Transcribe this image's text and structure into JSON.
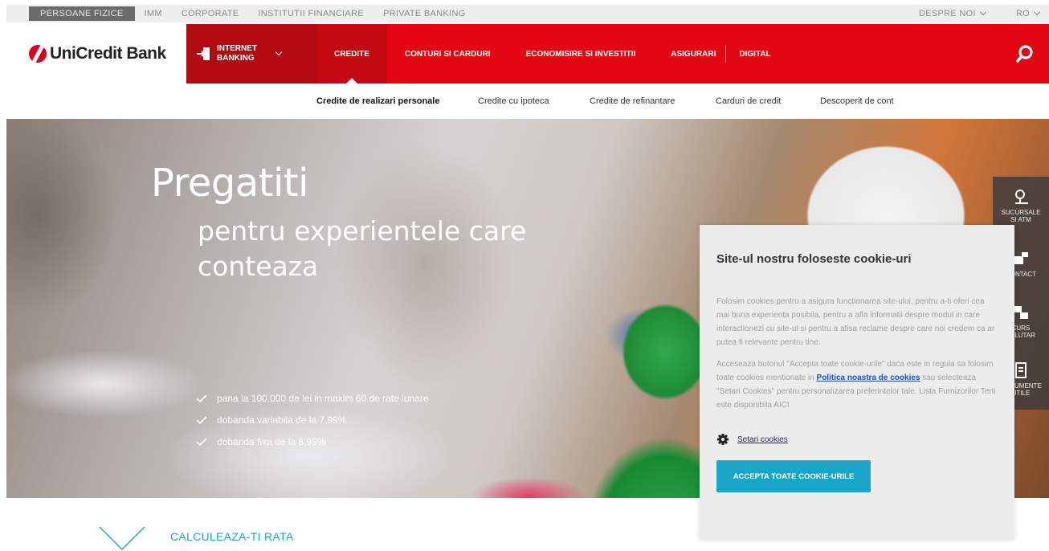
{
  "topbar": {
    "segments": [
      "PERSOANE FIZICE",
      "IMM",
      "CORPORATE",
      "INSTITUTII FINANCIARE",
      "PRIVATE BANKING"
    ],
    "about": "DESPRE NOI",
    "lang": "RO"
  },
  "brand": {
    "name": "UniCredit Bank",
    "color": "#e30613"
  },
  "nav": {
    "internet_banking": "INTERNET\nBANKING",
    "items": [
      "CREDITE",
      "CONTURI SI CARDURI",
      "ECONOMISIRE SI INVESTITII",
      "ASIGURARI",
      "DIGITAL"
    ]
  },
  "subnav": [
    "Credite de realizari personale",
    "Credite cu ipoteca",
    "Credite de refinantare",
    "Carduri de credit",
    "Descoperit de cont"
  ],
  "hero": {
    "title": "Pregatiti",
    "subtitle": "pentru experientele care\nconteaza",
    "bullets": [
      "pana la 100.000 de lei in maxim 60 de rate lunare",
      "dobanda variabila de la 7,99%",
      "dobanda fixa de la 8,99%"
    ]
  },
  "side_widget": [
    "SUCURSALE\nSI ATM",
    "CONTACT",
    "CURS\nVALUTAR",
    "DOCUMENTE\nUTILE"
  ],
  "cookie": {
    "title": "Site-ul nostru foloseste cookie-uri",
    "para1": "Folosim cookies pentru a asigura functionarea site-ului, pentru a-ti oferi cea mai buna experienta posibila, pentru a afla informatii despre modul in care interactionezi cu site-ul si pentru a afisa reclame despre care noi credem ca ar putea fi relevante pentru tine.",
    "para2_a": "Acceseaza butonul \"Accepta toate cookie-urile\" daca este in regula sa folosim toate cookies mentionate in ",
    "para2_link": "Politica noastra de cookies",
    "para2_b": " sau selecteaza \"Setari Cookies\" pentru personalizarea preferintelor tale. Lista Furnizorilor Terti este disponibila AICI",
    "settings": "Setari cookies",
    "accept": "ACCEPTA TOATE COOKIE-URILE",
    "accent": "#19a5c8"
  },
  "calc": {
    "label": "CALCULEAZA-TI RATA"
  }
}
